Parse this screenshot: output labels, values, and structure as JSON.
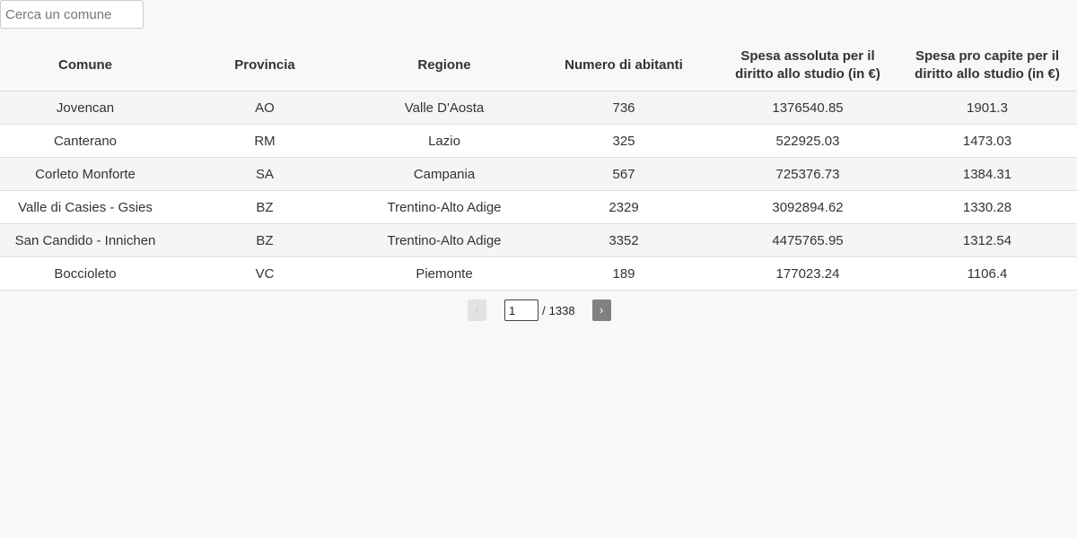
{
  "search": {
    "placeholder": "Cerca un comune",
    "value": ""
  },
  "table": {
    "columns": [
      "Comune",
      "Provincia",
      "Regione",
      "Numero di abitanti",
      "Spesa assoluta per il diritto allo studio (in €)",
      "Spesa pro capite per il diritto allo studio (in €)"
    ],
    "rows": [
      [
        "Jovencan",
        "AO",
        "Valle D'Aosta",
        "736",
        "1376540.85",
        "1901.3"
      ],
      [
        "Canterano",
        "RM",
        "Lazio",
        "325",
        "522925.03",
        "1473.03"
      ],
      [
        "Corleto Monforte",
        "SA",
        "Campania",
        "567",
        "725376.73",
        "1384.31"
      ],
      [
        "Valle di Casies - Gsies",
        "BZ",
        "Trentino-Alto Adige",
        "2329",
        "3092894.62",
        "1330.28"
      ],
      [
        "San Candido - Innichen",
        "BZ",
        "Trentino-Alto Adige",
        "3352",
        "4475765.95",
        "1312.54"
      ],
      [
        "Boccioleto",
        "VC",
        "Piemonte",
        "189",
        "177023.24",
        "1106.4"
      ]
    ]
  },
  "pagination": {
    "prev_label": "‹",
    "next_label": "›",
    "current_page": "1",
    "separator": "/",
    "total_pages": "1338"
  }
}
